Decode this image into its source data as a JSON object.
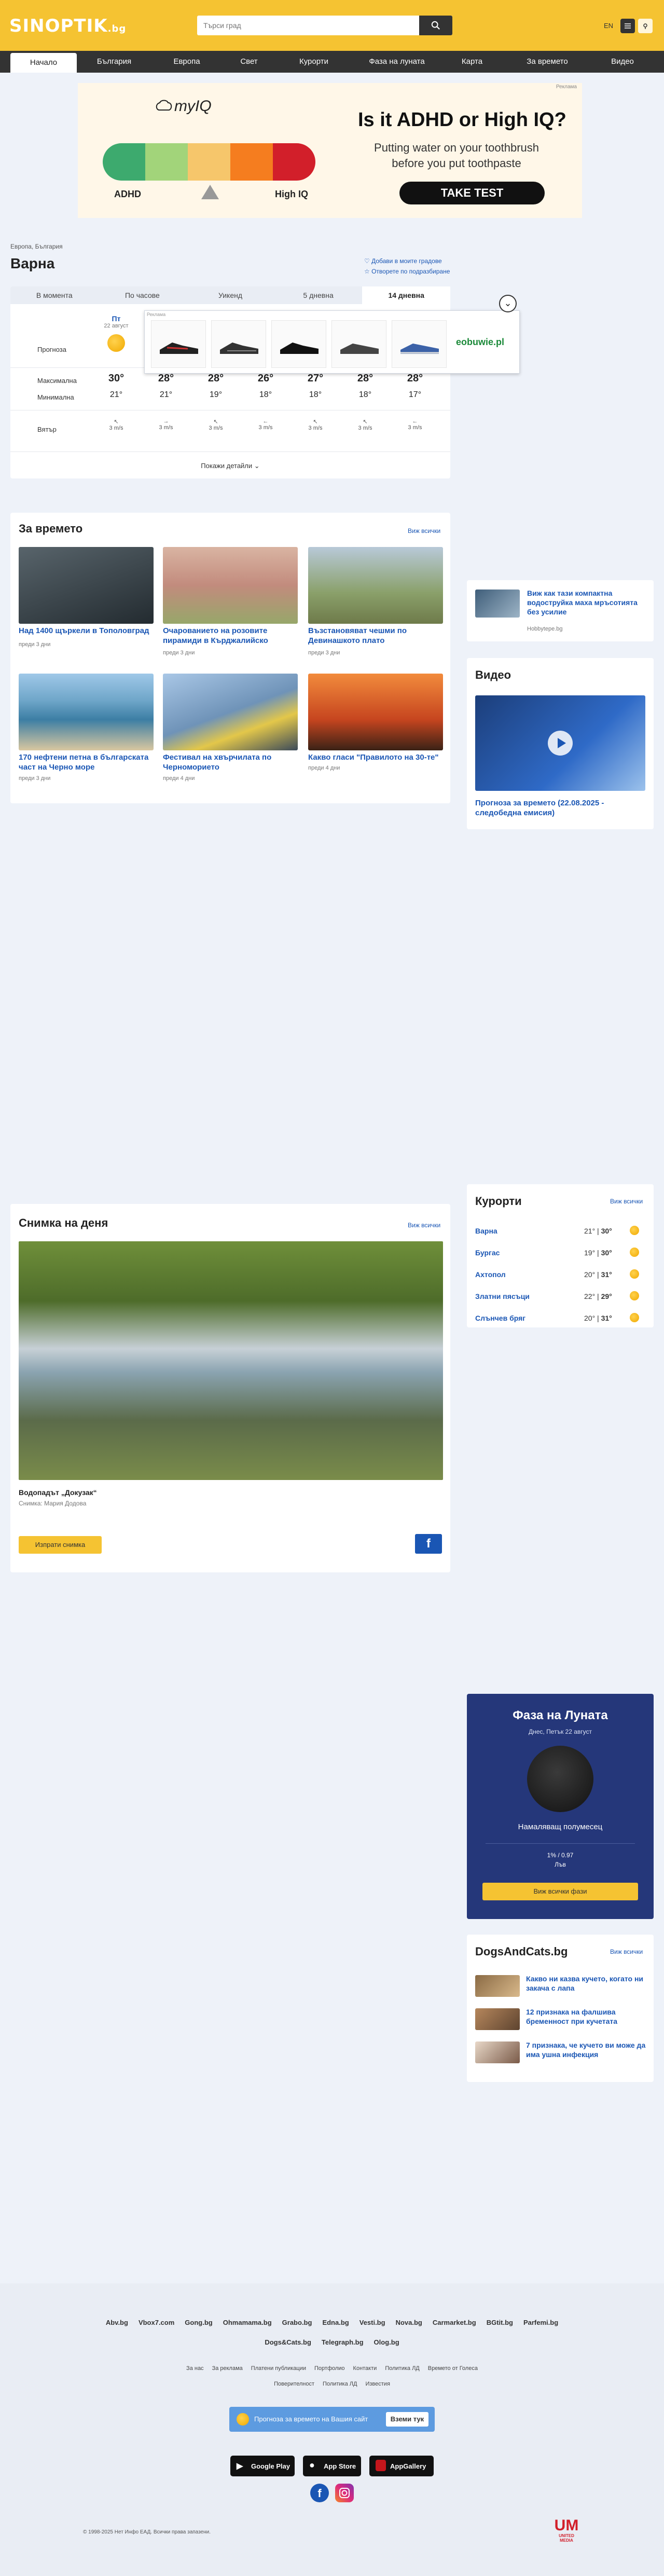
{
  "header": {
    "logo": "SINOPTIK",
    "logo_tld": ".bg",
    "search_placeholder": "Търси град",
    "lang": "EN"
  },
  "nav": [
    "Начало",
    "България",
    "Европа",
    "Свет",
    "Курорти",
    "Фаза на луната",
    "Карта",
    "За времето",
    "Видео"
  ],
  "ad": {
    "label": "Реклама",
    "brand": "myIQ",
    "scale_left": "ADHD",
    "scale_right": "High IQ",
    "headline": "Is it ADHD or High IQ?",
    "text": "Putting water on your toothbrush before you put toothpaste",
    "cta": "TAKE TEST",
    "colors": [
      "#3daa6e",
      "#a2d47a",
      "#f6c66b",
      "#f57d1f",
      "#d21f2a"
    ]
  },
  "location": {
    "breadcrumb": "Европа, България",
    "city": "Варна",
    "fav_add": "Добави в моите градове",
    "fav_remove": "Отворете по подразбиране"
  },
  "forecast": {
    "tabs": [
      "В момента",
      "По часове",
      "Уикенд",
      "5 дневна",
      "14 дневна"
    ],
    "active_tab": "14 дневна",
    "row_labels": {
      "forecast": "Прогноза",
      "max": "Максимална",
      "min": "Минимална",
      "wind": "Вятър"
    },
    "days": [
      {
        "name": "Пт",
        "date": "22 август",
        "max": "30°",
        "min": "21°",
        "wind": "3 m/s"
      },
      {
        "name": "Сб",
        "date": "23 август",
        "max": "28°",
        "min": "21°",
        "wind": "3 m/s"
      },
      {
        "name": "Нд",
        "date": "24 август",
        "max": "28°",
        "min": "19°",
        "wind": "3 m/s"
      },
      {
        "name": "Пн",
        "date": "25 август",
        "max": "26°",
        "min": "18°",
        "wind": "3 m/s"
      },
      {
        "name": "Вт",
        "date": "26 август",
        "max": "27°",
        "min": "18°",
        "wind": "3 m/s"
      },
      {
        "name": "Ср",
        "date": "27 август",
        "max": "28°",
        "min": "18°",
        "wind": "3 m/s"
      },
      {
        "name": "Чт",
        "date": "28 август",
        "max": "28°",
        "min": "17°",
        "wind": "3 m/s"
      }
    ],
    "show_details": "Покажи детайли",
    "shoe_ad_label": "Реклама",
    "shoe_brand": "eobuwie.pl"
  },
  "news": {
    "title": "За времето",
    "see_all": "Виж всички",
    "items": [
      {
        "title": "Над 1400 щъркели в Тополовград",
        "time": "преди 3 дни"
      },
      {
        "title": "Очарованието на розовите пирамиди в Кърджалийско",
        "time": "преди 3 дни"
      },
      {
        "title": "Възстановяват чешми по Девинашкото плато",
        "time": "преди 3 дни"
      },
      {
        "title": "170 нефтени петна в българската част на Черно море",
        "time": "преди 3 дни"
      },
      {
        "title": "Фестивал на хвърчилата по Черноморието",
        "time": "преди 4 дни"
      },
      {
        "title": "Какво гласи \"Правилото на 30-те\"",
        "time": "преди 4 дни"
      }
    ]
  },
  "promo": {
    "title": "Виж как тази компактна водоструйка маха мръсотията без усилие",
    "source": "Hobbytepe.bg"
  },
  "video": {
    "title": "Видео",
    "caption": "Прогноза за времето (22.08.2025 - следобедна емисия)"
  },
  "photo": {
    "title": "Снимка на деня",
    "see_all": "Виж всички",
    "caption": "Водопадът „Докузак“",
    "author": "Снимка: Мария Додова",
    "send": "Изпрати снимка"
  },
  "resorts": {
    "title": "Курорти",
    "see_all": "Виж всички",
    "items": [
      {
        "name": "Варна",
        "min": "21°",
        "max": "30°"
      },
      {
        "name": "Бургас",
        "min": "19°",
        "max": "30°"
      },
      {
        "name": "Ахтопол",
        "min": "20°",
        "max": "31°"
      },
      {
        "name": "Златни пясъци",
        "min": "22°",
        "max": "29°"
      },
      {
        "name": "Слънчев бряг",
        "min": "20°",
        "max": "31°"
      }
    ]
  },
  "moon": {
    "title": "Фаза на Луната",
    "date": "Днес, Петък 22 август",
    "phase": "Намаляващ полумесец",
    "illum": "1% / 0.97",
    "sign": "Лъв",
    "button": "Виж всички фази"
  },
  "dogs": {
    "title": "DogsAndCats.bg",
    "see_all": "Виж всички",
    "items": [
      "Какво ни казва кучето, когато ни закача с лапа",
      "12 признака на фалшива бременност при кучетата",
      "7 признака, че кучето ви може да има ушна инфекция"
    ]
  },
  "footer": {
    "partners1": [
      "Abv.bg",
      "Vbox7.com",
      "Gong.bg",
      "Ohmamama.bg",
      "Grabo.bg",
      "Edna.bg",
      "Vesti.bg",
      "Nova.bg",
      "Carmarket.bg",
      "BGtit.bg",
      "Parfemi.bg"
    ],
    "partners2": [
      "Dogs&Cats.bg",
      "Telegraph.bg",
      "Olog.bg"
    ],
    "links1": [
      "За нас",
      "За реклама",
      "Платени публикации",
      "Портфолио",
      "Контакти",
      "Политика ЛД",
      "Времето от Голеса"
    ],
    "links2": [
      "Поверителност",
      "Политика ЛД",
      "Известия"
    ],
    "widget_text": "Прогноза за времето на Вашия сайт",
    "widget_btn": "Вземи тук",
    "stores": [
      "Google Play",
      "App Store",
      "AppGallery"
    ],
    "copyright": "© 1998-2025 Нет Инфо ЕАД. Всички права запазени.",
    "brand": "UNITED MEDIA"
  }
}
